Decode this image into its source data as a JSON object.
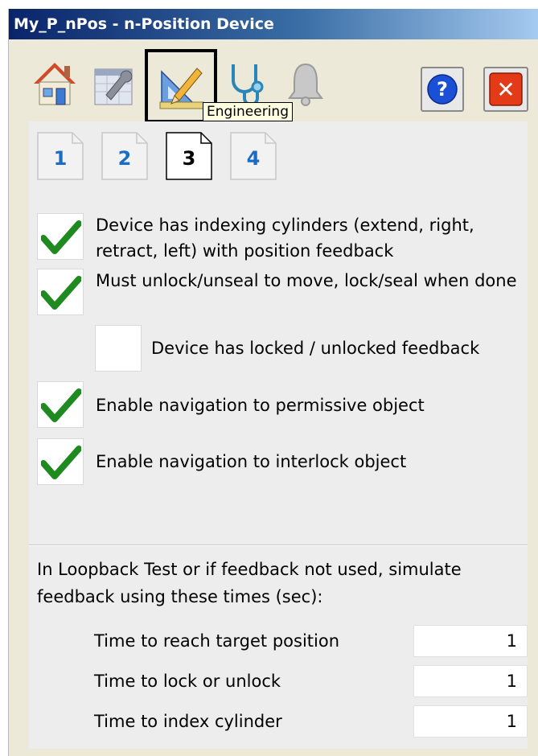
{
  "window": {
    "title": "My_P_nPos - n-Position Device"
  },
  "toolbar": {
    "icons": [
      "home-icon",
      "maintenance-icon",
      "engineering-icon",
      "diagnostics-icon",
      "alarm-icon"
    ],
    "tooltip": "Engineering",
    "help_label": "?",
    "close_label": "✕",
    "accent_selected": "#000000"
  },
  "pages": [
    "1",
    "2",
    "3",
    "4"
  ],
  "active_page": "3",
  "options": [
    {
      "label": "Device has indexing cylinders (extend, right, retract, left) with position feedback",
      "checked": true
    },
    {
      "label": "Must unlock/unseal to move, lock/seal when done",
      "checked": true
    },
    {
      "label": "Device has locked / unlocked feedback",
      "checked": false
    },
    {
      "label": "Enable navigation to permissive object",
      "checked": true
    },
    {
      "label": "Enable navigation to interlock object",
      "checked": true
    }
  ],
  "sim": {
    "description": "In Loopback Test or if feedback not used, simulate feedback using these times (sec):",
    "rows": [
      {
        "label": "Time to reach target position",
        "value": "1"
      },
      {
        "label": "Time to lock or unlock",
        "value": "1"
      },
      {
        "label": "Time to index cylinder",
        "value": "1"
      }
    ]
  },
  "colors": {
    "check": "#1f8a1f",
    "page_number": "#1a6cc4",
    "close": "#e33a18",
    "help": "#1a4fd6"
  }
}
